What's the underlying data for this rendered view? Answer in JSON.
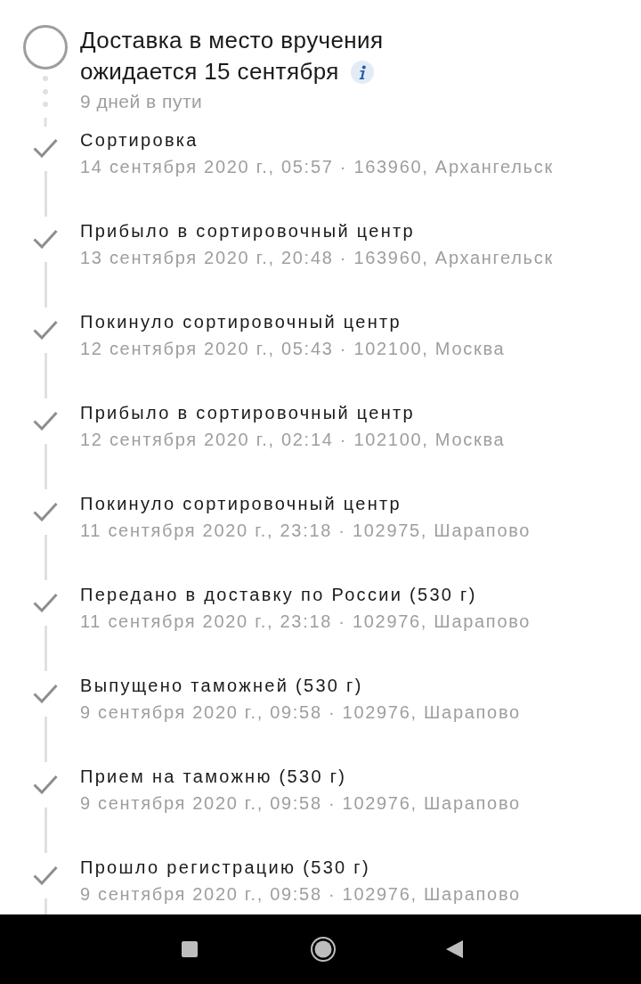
{
  "delivery": {
    "title_lines": [
      "Доставка в место вручения",
      "ожидается 15 сентября"
    ],
    "subtitle": "9 дней в пути"
  },
  "events": [
    {
      "title": "Сортировка",
      "detail": "14 сентября 2020 г., 05:57 · 163960, Архангельск",
      "completed": true
    },
    {
      "title": "Прибыло в сортировочный центр",
      "detail": "13 сентября 2020 г., 20:48 · 163960, Архангельск",
      "completed": true
    },
    {
      "title": "Покинуло сортировочный центр",
      "detail": "12 сентября 2020 г., 05:43 · 102100, Москва",
      "completed": true
    },
    {
      "title": "Прибыло в сортировочный центр",
      "detail": "12 сентября 2020 г., 02:14 · 102100, Москва",
      "completed": true
    },
    {
      "title": "Покинуло сортировочный центр",
      "detail": "11 сентября 2020 г., 23:18 · 102975, Шарапово",
      "completed": true
    },
    {
      "title": "Передано в доставку по России (530 г)",
      "detail": "11 сентября 2020 г., 23:18 · 102976, Шарапово",
      "completed": true
    },
    {
      "title": "Выпущено таможней (530 г)",
      "detail": "9 сентября 2020 г., 09:58 · 102976, Шарапово",
      "completed": true
    },
    {
      "title": "Прием на таможню (530 г)",
      "detail": "9 сентября 2020 г., 09:58 · 102976, Шарапово",
      "completed": true
    },
    {
      "title": "Прошло регистрацию (530 г)",
      "detail": "9 сентября 2020 г., 09:58 · 102976, Шарапово",
      "completed": true
    }
  ]
}
